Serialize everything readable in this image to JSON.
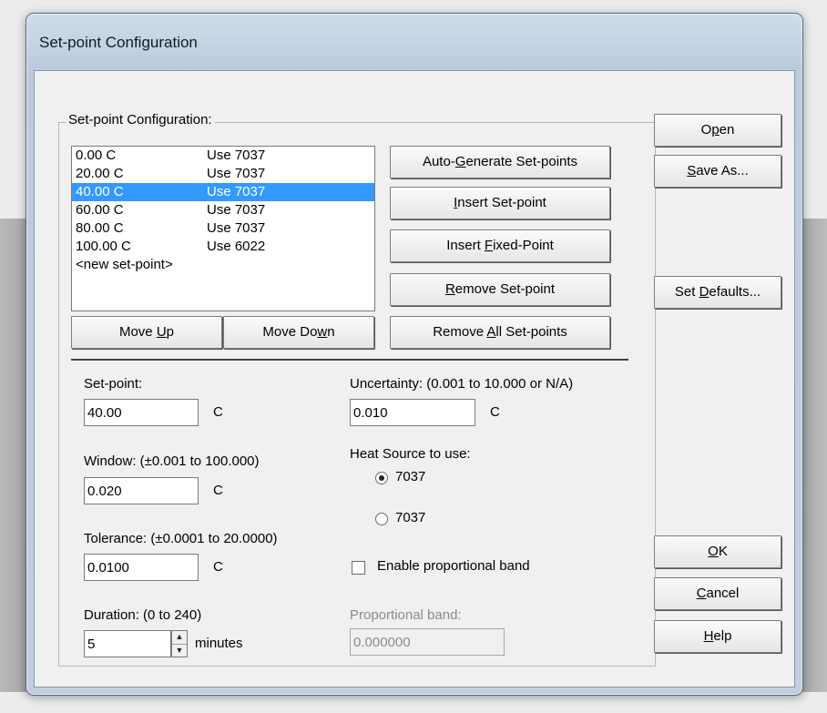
{
  "window": {
    "title": "Set-point Configuration"
  },
  "group": {
    "legend": "Set-point Configuration:"
  },
  "setpoints": [
    {
      "temp": "0.00 C",
      "source": "Use 7037",
      "selected": false
    },
    {
      "temp": "20.00 C",
      "source": "Use 7037",
      "selected": false
    },
    {
      "temp": "40.00 C",
      "source": "Use 7037",
      "selected": true
    },
    {
      "temp": "60.00 C",
      "source": "Use 7037",
      "selected": false
    },
    {
      "temp": "80.00 C",
      "source": "Use 7037",
      "selected": false
    },
    {
      "temp": "100.00 C",
      "source": "Use 6022",
      "selected": false
    },
    {
      "temp": "<new set-point>",
      "source": "",
      "selected": false
    }
  ],
  "buttons": {
    "auto_generate": {
      "pre": "Auto-",
      "key": "G",
      "post": "enerate Set-points"
    },
    "insert_setpoint": {
      "pre": "",
      "key": "I",
      "post": "nsert Set-point"
    },
    "insert_fixed": {
      "pre": "Insert ",
      "key": "F",
      "post": "ixed-Point"
    },
    "remove_setpoint": {
      "pre": "",
      "key": "R",
      "post": "emove Set-point"
    },
    "remove_all": {
      "pre": "Remove ",
      "key": "A",
      "post": "ll Set-points"
    },
    "move_up": {
      "pre": "Move ",
      "key": "U",
      "post": "p"
    },
    "move_down": {
      "pre": "Move Do",
      "key": "w",
      "post": "n"
    },
    "open": {
      "pre": "O",
      "key": "p",
      "post": "en"
    },
    "save_as": {
      "pre": "",
      "key": "S",
      "post": "ave As..."
    },
    "set_defaults": {
      "pre": "Set ",
      "key": "D",
      "post": "efaults..."
    },
    "ok": {
      "pre": "",
      "key": "O",
      "post": "K"
    },
    "cancel": {
      "pre": "",
      "key": "C",
      "post": "ancel"
    },
    "help": {
      "pre": "",
      "key": "H",
      "post": "elp"
    }
  },
  "fields": {
    "setpoint": {
      "label": "Set-point:",
      "value": "40.00",
      "unit": "C"
    },
    "window": {
      "label": "Window: (±0.001 to 100.000)",
      "value": "0.020",
      "unit": "C"
    },
    "tolerance": {
      "label": "Tolerance: (±0.0001 to 20.0000)",
      "value": "0.0100",
      "unit": "C"
    },
    "duration": {
      "label": "Duration: (0 to 240)",
      "value": "5",
      "unit": "minutes"
    },
    "uncertainty": {
      "label": "Uncertainty: (0.001 to 10.000 or N/A)",
      "value": "0.010",
      "unit": "C"
    },
    "heat_source": {
      "label": "Heat Source to use:",
      "option1": "7037",
      "option2": "7037",
      "selected": 1
    },
    "proportional_enable": {
      "label": "Enable proportional band",
      "checked": false
    },
    "proportional_band": {
      "label": "Proportional band:",
      "value": "0.000000",
      "enabled": false
    }
  }
}
